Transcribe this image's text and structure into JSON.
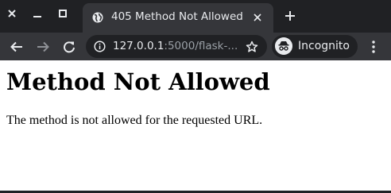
{
  "browser": {
    "tab": {
      "title": "405 Method Not Allowed",
      "favicon": "globe-icon"
    },
    "address_bar": {
      "url_host": "127.0.0.1",
      "url_path": ":5000/flask-..."
    },
    "profile": {
      "label": "Incognito",
      "icon": "incognito-icon"
    },
    "colors": {
      "frame": "#202124",
      "tab_active": "#35363a",
      "text": "#e8eaed",
      "muted_text": "#9aa0a6"
    }
  },
  "page": {
    "title": "Method Not Allowed",
    "message": "The method is not allowed for the requested URL."
  }
}
